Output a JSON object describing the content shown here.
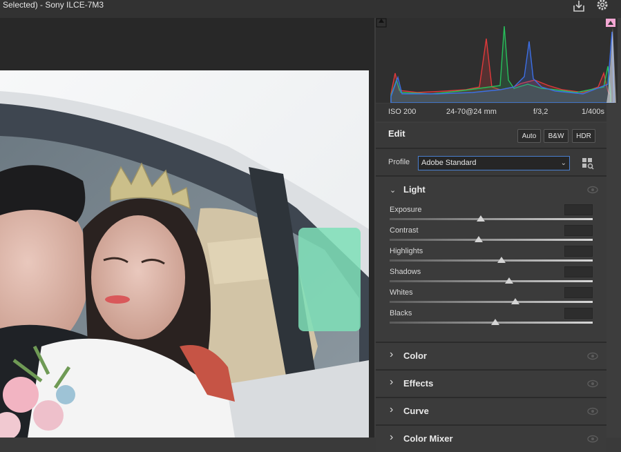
{
  "window": {
    "title": "Selected)  -  Sony ILCE-7M3"
  },
  "toolbar": {
    "icons": [
      "download-icon",
      "gear-icon"
    ]
  },
  "histogram": {
    "colors": {
      "red": "#e0393b",
      "green": "#27c15b",
      "blue": "#3d6fe6",
      "white": "#e8e8e8"
    }
  },
  "camera_info": {
    "iso": "ISO 200",
    "lens": "24-70@24 mm",
    "aperture": "f/3,2",
    "shutter": "1/400s"
  },
  "edit": {
    "title": "Edit",
    "buttons": [
      "Auto",
      "B&W",
      "HDR"
    ],
    "profile_label": "Profile",
    "profile_value": "Adobe Standard"
  },
  "light": {
    "title": "Light",
    "sliders": [
      {
        "label": "Exposure",
        "value": 0.45,
        "readout": ""
      },
      {
        "label": "Contrast",
        "value": 0.44,
        "readout": ""
      },
      {
        "label": "Highlights",
        "value": 0.55,
        "readout": ""
      },
      {
        "label": "Shadows",
        "value": 0.59,
        "readout": ""
      },
      {
        "label": "Whites",
        "value": 0.62,
        "readout": ""
      },
      {
        "label": "Blacks",
        "value": 0.52,
        "readout": ""
      }
    ]
  },
  "groups": [
    {
      "title": "Color"
    },
    {
      "title": "Effects"
    },
    {
      "title": "Curve"
    },
    {
      "title": "Color Mixer"
    }
  ]
}
